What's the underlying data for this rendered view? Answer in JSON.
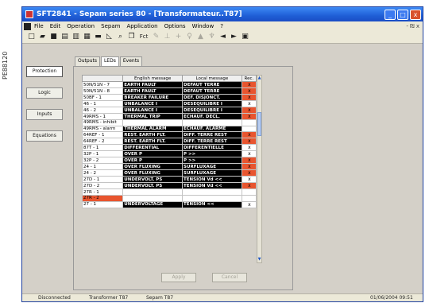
{
  "side_caption": "PE88120",
  "window": {
    "title": "SFT2841 - Sepam series 80 - [Transformateur..T87]",
    "caption_buttons": [
      "_",
      "□",
      "x"
    ]
  },
  "menu": {
    "items": [
      "File",
      "Edit",
      "Operation",
      "Sepam",
      "Application",
      "Options",
      "Window",
      "?"
    ],
    "mdi_controls": "- ₪ x"
  },
  "toolbar": {
    "icons": [
      {
        "name": "new-icon",
        "glyph": "□",
        "enabled": true
      },
      {
        "name": "open-icon",
        "glyph": "▰",
        "enabled": true
      },
      {
        "name": "save-icon",
        "glyph": "■",
        "enabled": true
      },
      {
        "name": "sepam-connect-icon",
        "glyph": "▤",
        "enabled": true
      },
      {
        "name": "sepam-copy-icon",
        "glyph": "▥",
        "enabled": true
      },
      {
        "name": "sepam-send-icon",
        "glyph": "▦",
        "enabled": true
      },
      {
        "name": "print-icon",
        "glyph": "▬",
        "enabled": true
      },
      {
        "name": "chart-icon",
        "glyph": "◺",
        "enabled": true
      },
      {
        "name": "zoom-icon",
        "glyph": "⌕",
        "enabled": true
      },
      {
        "name": "copy-icon",
        "glyph": "❐",
        "enabled": true
      },
      {
        "name": "function-icon",
        "glyph": "Fct",
        "enabled": true
      },
      {
        "name": "wrench-icon",
        "glyph": "✎",
        "enabled": false
      },
      {
        "name": "tool2-icon",
        "glyph": "⊥",
        "enabled": false
      },
      {
        "name": "tool3-icon",
        "glyph": "+",
        "enabled": false
      },
      {
        "name": "tool4-icon",
        "glyph": "♀",
        "enabled": false
      },
      {
        "name": "tool5-icon",
        "glyph": "▲",
        "enabled": false
      },
      {
        "name": "tool6-icon",
        "glyph": "♆",
        "enabled": false
      },
      {
        "name": "arrow-left-icon",
        "glyph": "◄",
        "enabled": true
      },
      {
        "name": "arrow-right-icon",
        "glyph": "►",
        "enabled": true
      },
      {
        "name": "report-icon",
        "glyph": "▣",
        "enabled": true
      }
    ]
  },
  "sidenav": {
    "items": [
      "Protection",
      "Logic",
      "Inputs",
      "Equations"
    ],
    "active": "Protection"
  },
  "tabs": {
    "items": [
      "Outputs",
      "LEDs",
      "Events"
    ],
    "active": "LEDs"
  },
  "grid": {
    "headers": [
      "",
      "English message",
      "Local message",
      "Rec."
    ],
    "rows": [
      {
        "code": "50N/51N - 7",
        "en": "EARTH FAULT",
        "local": "DEFAUT TERRE",
        "rec": "x",
        "rec_bg": "red"
      },
      {
        "code": "50N/51N - 8",
        "en": "EARTH FAULT",
        "local": "DEFAUT TERRE",
        "rec": "x",
        "rec_bg": "red"
      },
      {
        "code": "50BF - 1",
        "en": "BREAKER FAILURE",
        "local": "DEF. DISJONCT.",
        "rec": "x",
        "rec_bg": "red"
      },
      {
        "code": "46 - 1",
        "en": "UNBALANCE I",
        "local": "DESEQUILIBRE I",
        "rec": "x",
        "rec_bg": "white"
      },
      {
        "code": "46 - 2",
        "en": "UNBALANCE I",
        "local": "DESEQUILIBRE I",
        "rec": "x",
        "rec_bg": "red"
      },
      {
        "code": "49RMS - 1",
        "en": "THERMAL TRIP",
        "local": "ECHAUF. DECL.",
        "rec": "x",
        "rec_bg": "red"
      },
      {
        "code": "49RMS - inhibit",
        "en": "",
        "local": "",
        "rec": "",
        "rec_bg": "white"
      },
      {
        "code": "49RMS - alarm",
        "en": "THERMAL ALARM",
        "local": "ECHAUF. ALARME",
        "rec": "",
        "rec_bg": "white"
      },
      {
        "code": "64REF - 1",
        "en": "REST. EARTH FLT.",
        "local": "DIFF. TERRE REST",
        "rec": "x",
        "rec_bg": "red"
      },
      {
        "code": "64REF - 2",
        "en": "REST. EARTH FLT.",
        "local": "DIFF. TERRE REST",
        "rec": "x",
        "rec_bg": "red"
      },
      {
        "code": "87T - 1",
        "en": "DIFFERENTIAL",
        "local": "DIFFERENTIELLE",
        "rec": "x",
        "rec_bg": "white"
      },
      {
        "code": "32P - 1",
        "en": "OVER P",
        "local": "P >>",
        "rec": "x",
        "rec_bg": "white"
      },
      {
        "code": "32P - 2",
        "en": "OVER P",
        "local": "P >>",
        "rec": "x",
        "rec_bg": "red"
      },
      {
        "code": "24 - 1",
        "en": "OVER FLUXING",
        "local": "SURFLUXAGE",
        "rec": "x",
        "rec_bg": "red"
      },
      {
        "code": "24 - 2",
        "en": "OVER FLUXING",
        "local": "SURFLUXAGE",
        "rec": "x",
        "rec_bg": "red"
      },
      {
        "code": "27D - 1",
        "en": "UNDERVOLT. PS",
        "local": "TENSION Vd <<",
        "rec": "x",
        "rec_bg": "white"
      },
      {
        "code": "27D - 2",
        "en": "UNDERVOLT. PS",
        "local": "TENSION Vd <<",
        "rec": "x",
        "rec_bg": "red"
      },
      {
        "code": "27R - 1",
        "en": "",
        "local": "",
        "rec": "",
        "rec_bg": "white"
      },
      {
        "code": "27R - 2",
        "en": "",
        "local": "",
        "rec": "",
        "rec_bg": "redrow"
      },
      {
        "code": "27 - 1",
        "en": "UNDERVOLTAGE",
        "local": "TENSION <<",
        "rec": "x",
        "rec_bg": "white"
      }
    ]
  },
  "buttons": {
    "apply": "Apply",
    "cancel": "Cancel"
  },
  "status": {
    "connection": "Disconnected",
    "equipment": "Transformer T87",
    "sepam": "Sepam T87",
    "datetime": "01/06/2004  09:51"
  }
}
